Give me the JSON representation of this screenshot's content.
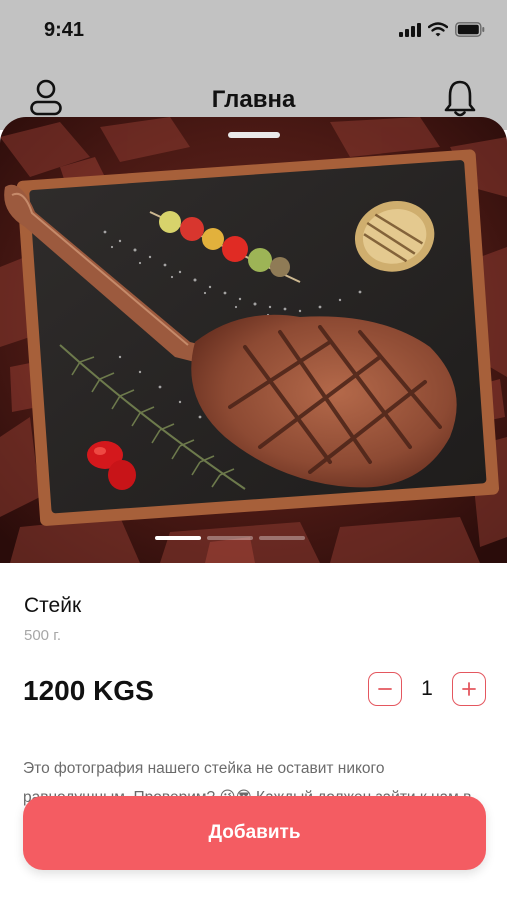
{
  "status_bar": {
    "time": "9:41"
  },
  "header": {
    "title": "Главна"
  },
  "product": {
    "name": "Стейк",
    "weight": "500 г.",
    "price": "1200 KGS",
    "quantity": "1",
    "description": "Это фотография нашего стейка не оставит никого равнодушным. Проверим? 😜😎 Каждый должен зайти к нам в гости!"
  },
  "carousel": {
    "slide_count": 3,
    "active_index": 0
  },
  "actions": {
    "add_label": "Добавить"
  },
  "colors": {
    "accent": "#f45c62",
    "stepper_border": "#e4575f",
    "header_bg": "#c2c2c2"
  },
  "icons": [
    "profile-icon",
    "bell-icon",
    "minus-icon",
    "plus-icon",
    "signal-icon",
    "wifi-icon",
    "battery-icon"
  ]
}
